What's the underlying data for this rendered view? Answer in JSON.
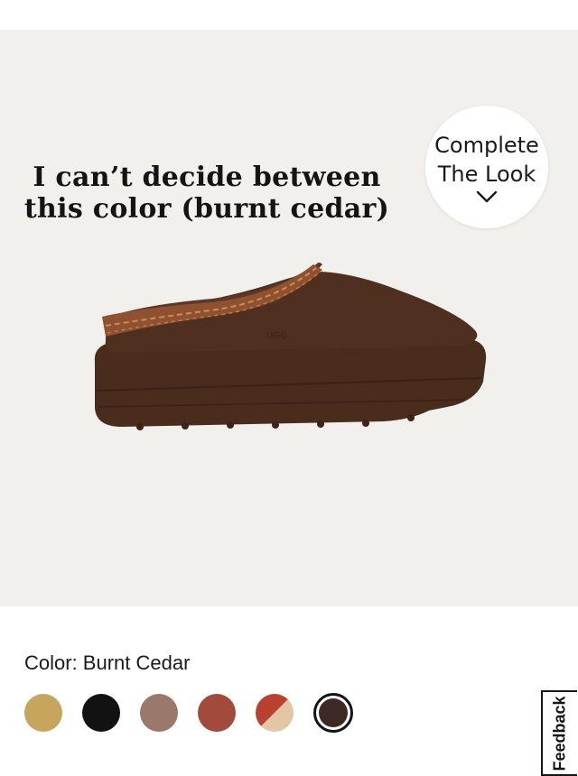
{
  "gallery": {
    "caption_line1": "I can’t decide between",
    "caption_line2": "this color (burnt cedar)",
    "complete_look_line1": "Complete",
    "complete_look_line2": "The Look",
    "complete_look_icon": "chevron-down-icon",
    "product_image": "brown-suede-slipper-image",
    "image_count": 6,
    "active_image_index": 0
  },
  "color": {
    "label": "Color: Burnt Cedar",
    "swatches": [
      {
        "color": "#c8a55c"
      },
      {
        "color": "#121212"
      },
      {
        "color": "#9a786c"
      },
      {
        "color": "#a24a3c"
      },
      {
        "color": "#b8412f",
        "color2": "#e3c6a4"
      },
      {
        "color": "#3e2a25",
        "selected": true
      }
    ]
  },
  "feedback": {
    "label": "Feedback"
  }
}
